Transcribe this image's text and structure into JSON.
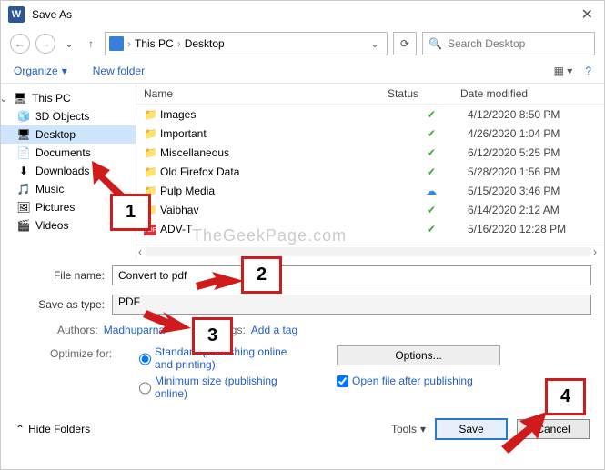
{
  "titlebar": {
    "app": "W",
    "title": "Save As"
  },
  "address": {
    "segments": [
      "This PC",
      "Desktop"
    ],
    "search_placeholder": "Search Desktop"
  },
  "toolbar": {
    "organize": "Organize",
    "new_folder": "New folder"
  },
  "sidebar": {
    "root": "This PC",
    "items": [
      {
        "label": "3D Objects",
        "icon": "🧊"
      },
      {
        "label": "Desktop",
        "icon": "🖥",
        "selected": true
      },
      {
        "label": "Documents",
        "icon": "📄"
      },
      {
        "label": "Downloads",
        "icon": "⬇"
      },
      {
        "label": "Music",
        "icon": "🎵"
      },
      {
        "label": "Pictures",
        "icon": "🖼"
      },
      {
        "label": "Videos",
        "icon": "🎬"
      }
    ]
  },
  "files": {
    "headers": {
      "name": "Name",
      "status": "Status",
      "date": "Date modified"
    },
    "rows": [
      {
        "name": "Images",
        "type": "folder",
        "status": "check",
        "date": "4/12/2020 8:50 PM"
      },
      {
        "name": "Important",
        "type": "folder",
        "status": "check",
        "date": "4/26/2020 1:04 PM"
      },
      {
        "name": "Miscellaneous",
        "type": "folder",
        "status": "check",
        "date": "6/12/2020 5:25 PM"
      },
      {
        "name": "Old Firefox Data",
        "type": "folder",
        "status": "check",
        "date": "5/28/2020 1:56 PM"
      },
      {
        "name": "Pulp Media",
        "type": "folder",
        "status": "cloud",
        "date": "5/15/2020 3:46 PM"
      },
      {
        "name": "Vaibhav",
        "type": "folder",
        "status": "check",
        "date": "6/14/2020 2:12 AM"
      },
      {
        "name": "ADV-T",
        "type": "pdf",
        "status": "check",
        "date": "5/16/2020 12:28 PM"
      }
    ]
  },
  "form": {
    "file_name_label": "File name:",
    "file_name_value": "Convert to pdf",
    "save_type_label": "Save as type:",
    "save_type_value": "PDF",
    "authors_label": "Authors:",
    "authors_value": "Madhuparna",
    "tags_label": "Tags:",
    "tags_value": "Add a tag",
    "optimize_label": "Optimize for:",
    "radio_standard": "Standard (publishing online and printing)",
    "radio_min": "Minimum size (publishing online)",
    "options_btn": "Options...",
    "open_after": "Open file after publishing"
  },
  "footer": {
    "hide_folders": "Hide Folders",
    "tools": "Tools",
    "save": "Save",
    "cancel": "Cancel"
  },
  "annotations": {
    "a1": "1",
    "a2": "2",
    "a3": "3",
    "a4": "4"
  },
  "watermark": "TheGeekPage.com"
}
